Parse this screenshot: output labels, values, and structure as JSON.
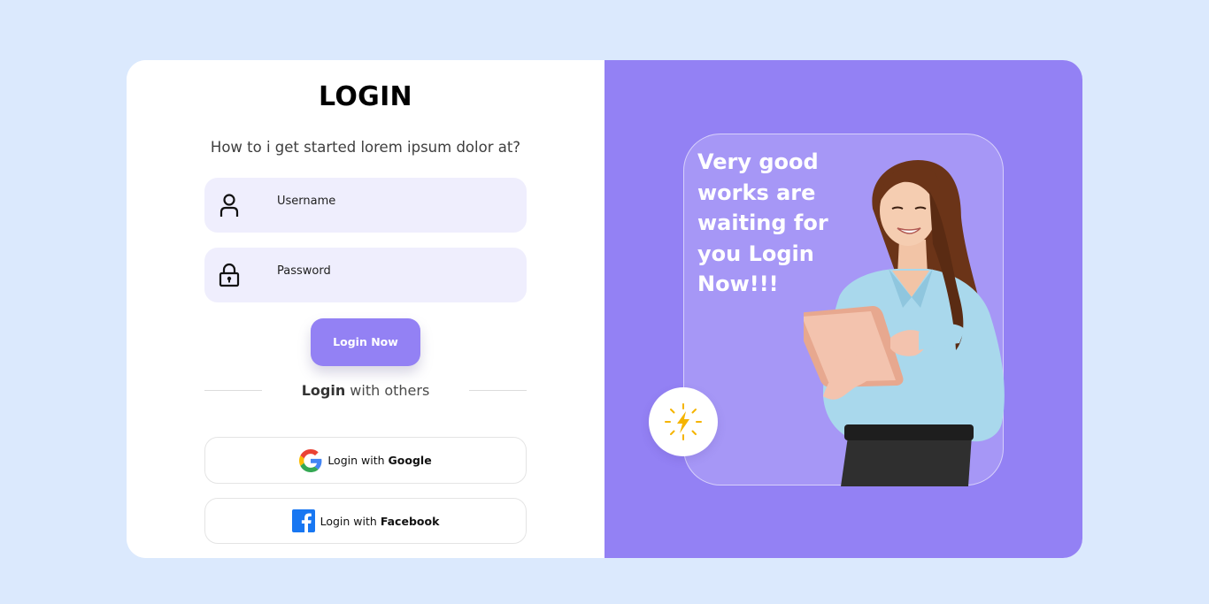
{
  "login": {
    "title": "LOGIN",
    "subtitle": "How to i get started lorem ipsum dolor at?",
    "username_label": "Username",
    "password_label": "Password",
    "submit_label": "Login Now",
    "divider": {
      "bold": "Login",
      "rest": " with others"
    },
    "google": {
      "prefix": "Login with",
      "brand": "Google"
    },
    "facebook": {
      "prefix": "Login with",
      "brand": "Facebook"
    }
  },
  "hero": {
    "lines": [
      "Very good",
      "works are",
      "waiting for",
      "you Login",
      "Now!!!"
    ]
  },
  "colors": {
    "page_bg": "#dbe9fd",
    "accent": "#9381f4",
    "field_bg": "#efeefd",
    "badge_bolt": "#f5b400"
  },
  "icons": {
    "username": "user-icon",
    "password": "lock-icon",
    "google": "google-icon",
    "facebook": "facebook-icon",
    "badge": "lightning-icon"
  }
}
